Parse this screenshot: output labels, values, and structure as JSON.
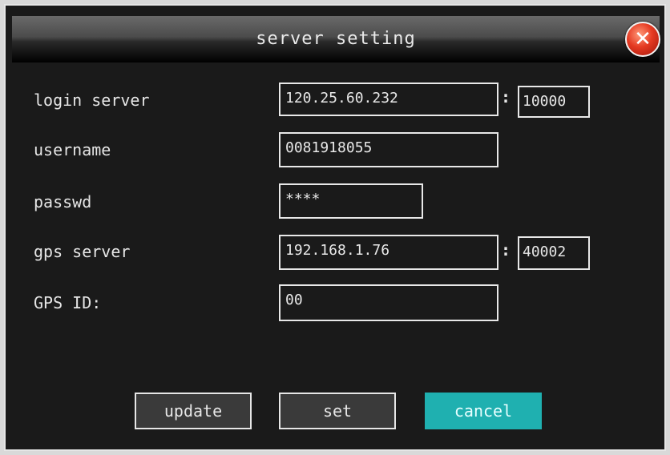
{
  "dialog": {
    "title": "server setting",
    "close_icon": "close-icon"
  },
  "fields": {
    "login_server": {
      "label": "login server",
      "host": "120.25.60.232",
      "separator": ":",
      "port": "10000"
    },
    "username": {
      "label": "username",
      "value": "0081918055"
    },
    "passwd": {
      "label": "passwd",
      "value": "****"
    },
    "gps_server": {
      "label": "gps server",
      "host": "192.168.1.76",
      "separator": ":",
      "port": "40002"
    },
    "gps_id": {
      "label": "GPS ID:",
      "value": "00"
    }
  },
  "buttons": {
    "update": "update",
    "set": "set",
    "cancel": "cancel"
  },
  "colors": {
    "background": "#1a1a1a",
    "accent": "#1fb0b0",
    "close": "#e53a22",
    "text": "#e6e6e6"
  }
}
